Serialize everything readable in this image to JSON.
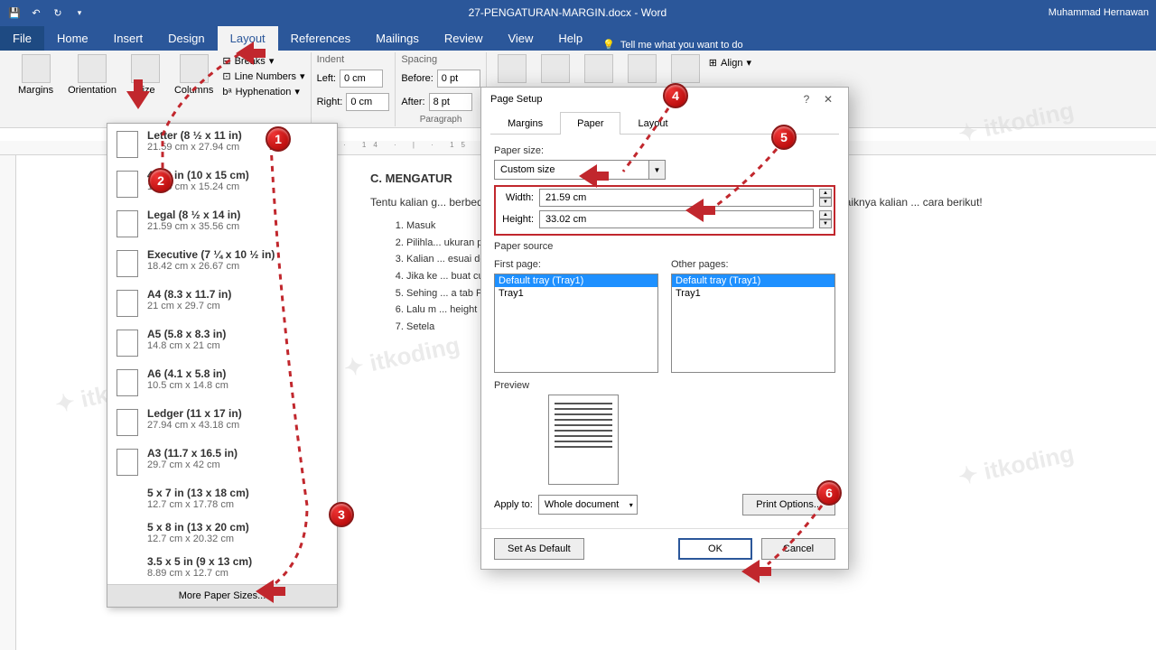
{
  "title": "27-PENGATURAN-MARGIN.docx - Word",
  "user": "Muhammad Hernawan",
  "menu": {
    "file": "File",
    "home": "Home",
    "insert": "Insert",
    "design": "Design",
    "layout": "Layout",
    "references": "References",
    "mailings": "Mailings",
    "review": "Review",
    "view": "View",
    "help": "Help",
    "tell": "Tell me what you want to do"
  },
  "ribbon": {
    "margins": "Margins",
    "orientation": "Orientation",
    "size": "Size",
    "columns": "Columns",
    "breaks": "Breaks",
    "linenum": "Line Numbers",
    "hyph": "Hyphenation",
    "indent": "Indent",
    "left": "Left:",
    "right": "Right:",
    "lval": "0 cm",
    "rval": "0 cm",
    "spacing": "Spacing",
    "before": "Before:",
    "after": "After:",
    "bval": "0 pt",
    "aval": "8 pt",
    "paragraph": "Paragraph",
    "align": "Align"
  },
  "sizes": [
    {
      "t": "Letter (8 ½ x 11 in)",
      "s": "21.59 cm x 27.94 cm"
    },
    {
      "t": "4 x 6 in (10 x 15 cm)",
      "s": "10.16 cm x 15.24 cm"
    },
    {
      "t": "Legal (8 ½ x 14 in)",
      "s": "21.59 cm x 35.56 cm"
    },
    {
      "t": "Executive (7 ¼ x 10 ½ in)",
      "s": "18.42 cm x 26.67 cm"
    },
    {
      "t": "A4 (8.3 x 11.7 in)",
      "s": "21 cm x 29.7 cm"
    },
    {
      "t": "A5 (5.8 x 8.3 in)",
      "s": "14.8 cm x 21 cm"
    },
    {
      "t": "A6 (4.1 x 5.8 in)",
      "s": "10.5 cm x 14.8 cm"
    },
    {
      "t": "Ledger (11 x 17 in)",
      "s": "27.94 cm x 43.18 cm"
    },
    {
      "t": "A3 (11.7 x 16.5 in)",
      "s": "29.7 cm x 42 cm"
    },
    {
      "t": "5 x 7 in (13 x 18 cm)",
      "s": "12.7 cm x 17.78 cm"
    },
    {
      "t": "5 x 8 in (13 x 20 cm)",
      "s": "12.7 cm x 20.32 cm"
    },
    {
      "t": "3.5 x 5 in (9 x 13 cm)",
      "s": "8.89 cm x 12.7 cm"
    }
  ],
  "more": "More Paper Sizes...",
  "rulerh": "· 14 · | · 15 · | · 16 · | · 17 · | · 18 · | · 19 ·",
  "doc": {
    "h": "C. MENGATUR",
    "p": "Tentu kalian g... berbeda dengan kertas yang s... yang berbeda antara tepi-te... maka dari itu ada baiknya kalian ... cara berikut!",
    "li": [
      "Masuk",
      "Pilihla... ukuran pada tiap-tiap ke",
      "Kalian ... esuai dengan kertas yang s",
      "Jika ke ... buat custom-nya denga",
      "Sehing ... a tab Paper, pada bagian",
      "Lalu m ... height umtuk menga",
      "Setela"
    ]
  },
  "dialog": {
    "title": "Page Setup",
    "tabs": {
      "margins": "Margins",
      "paper": "Paper",
      "layout": "Layout"
    },
    "psize": "Paper size:",
    "psval": "Custom size",
    "width": "Width:",
    "wval": "21.59 cm",
    "height": "Height:",
    "hval": "33.02 cm",
    "psource": "Paper source",
    "fpage": "First page:",
    "opage": "Other pages:",
    "tray": [
      "Default tray (Tray1)",
      "Tray1"
    ],
    "preview": "Preview",
    "apply": "Apply to:",
    "applyval": "Whole document",
    "po": "Print Options...",
    "setdef": "Set As Default",
    "ok": "OK",
    "cancel": "Cancel"
  },
  "badges": [
    "1",
    "2",
    "3",
    "4",
    "5",
    "6"
  ]
}
